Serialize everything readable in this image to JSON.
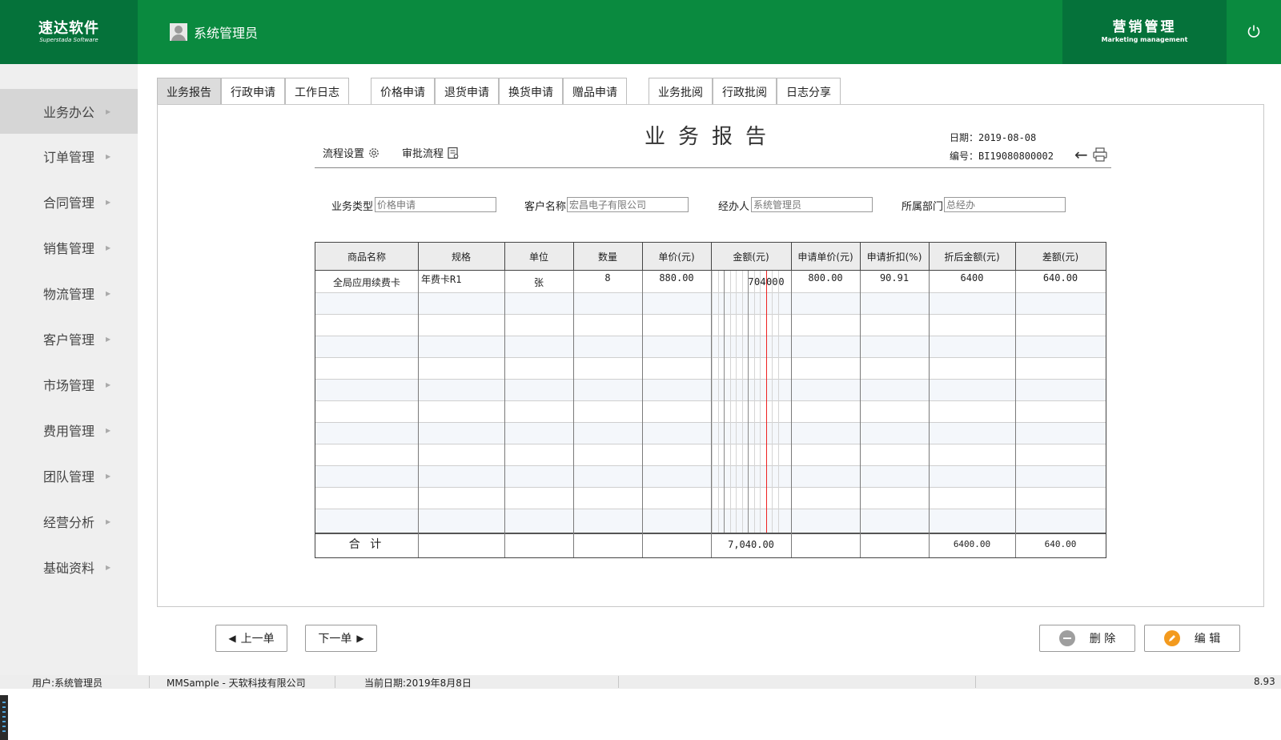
{
  "app": {
    "logo_title": "速达软件",
    "logo_subtitle": "Superstada Software",
    "user_name": "系统管理员",
    "module_title": "营销管理",
    "module_subtitle": "Marketing management",
    "brand_color": "#0a8a3f",
    "brand_dark": "#05723a"
  },
  "sidebar": {
    "items": [
      {
        "label": "业务办公",
        "active": true
      },
      {
        "label": "订单管理"
      },
      {
        "label": "合同管理"
      },
      {
        "label": "销售管理"
      },
      {
        "label": "物流管理"
      },
      {
        "label": "客户管理"
      },
      {
        "label": "市场管理"
      },
      {
        "label": "费用管理"
      },
      {
        "label": "团队管理"
      },
      {
        "label": "经营分析"
      },
      {
        "label": "基础资料"
      }
    ]
  },
  "tabs": [
    "业务报告",
    "行政申请",
    "工作日志",
    "价格申请",
    "退货申请",
    "换货申请",
    "赠品申请",
    "业务批阅",
    "行政批阅",
    "日志分享"
  ],
  "report": {
    "title": "业务报告",
    "flow_settings": "流程设置",
    "approval_flow": "审批流程",
    "date": "日期：2019-08-08",
    "number": "编号：BI19080800002",
    "fields": {
      "business_type_label": "业务类型",
      "business_type_value": "价格申请",
      "customer_label": "客户名称",
      "customer_value": "宏昌电子有限公司",
      "handler_label": "经办人",
      "handler_value": "系统管理员",
      "dept_label": "所属部门",
      "dept_value": "总经办"
    }
  },
  "table": {
    "headers": [
      "商品名称",
      "规格",
      "单位",
      "数量",
      "单价(元)",
      "金额(元)",
      "申请单价(元)",
      "申请折扣(%)",
      "折后金额(元)",
      "差额(元)"
    ],
    "row1": {
      "name": "全局应用续费卡",
      "spec": "年费卡R1",
      "unit": "张",
      "qty": "8",
      "price": "880.00",
      "amount_digits": [
        "7",
        "0",
        "4",
        "0",
        "0",
        "0"
      ],
      "apply_price": "800.00",
      "discount": "90.91",
      "discounted": "6400",
      "diff": "640.00"
    },
    "total": {
      "label": "合 计",
      "amount": "7,040.00",
      "discounted": "6400.00",
      "diff": "640.00"
    }
  },
  "buttons": {
    "prev": "上一单",
    "next": "下一单",
    "delete": "删 除",
    "edit": "编 辑"
  },
  "statusbar": {
    "user": "用户:系统管理员",
    "company": "MMSample - 天软科技有限公司",
    "date": "当前日期:2019年8月8日",
    "version": "8.93"
  }
}
